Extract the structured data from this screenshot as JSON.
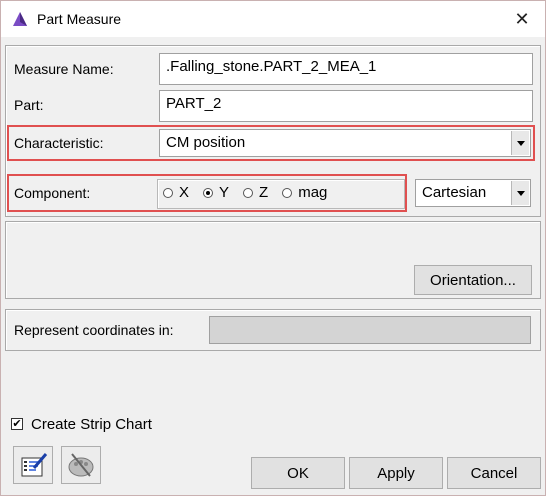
{
  "window": {
    "title": "Part Measure",
    "close_icon": "close-icon"
  },
  "form": {
    "measure_name_label": "Measure Name:",
    "measure_name_value": ".Falling_stone.PART_2_MEA_1",
    "part_label": "Part:",
    "part_value": "PART_2",
    "characteristic_label": "Characteristic:",
    "characteristic_value": "CM position",
    "component_label": "Component:",
    "component_options": [
      {
        "label": "X",
        "checked": false
      },
      {
        "label": "Y",
        "checked": true
      },
      {
        "label": "Z",
        "checked": false
      },
      {
        "label": "mag",
        "checked": false
      }
    ],
    "coord_system_value": "Cartesian",
    "orientation_button": "Orientation...",
    "represent_label": "Represent coordinates in:",
    "represent_value": ""
  },
  "footer": {
    "strip_chart_label": "Create Strip Chart",
    "strip_chart_checked": true,
    "ok_button": "OK",
    "apply_button": "Apply",
    "cancel_button": "Cancel"
  },
  "colors": {
    "highlight": "#e05050",
    "accent": "#6a3fa0"
  }
}
